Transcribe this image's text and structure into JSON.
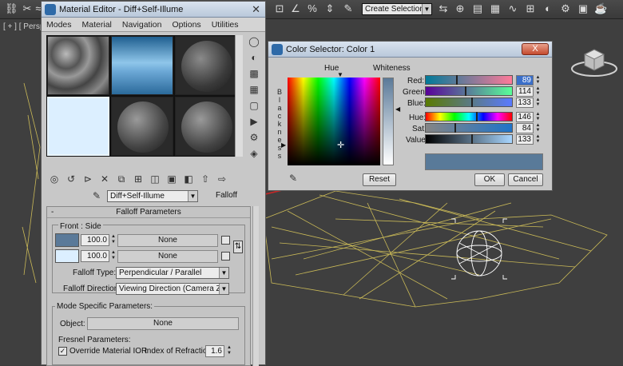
{
  "toolbar": {
    "selection_set_placeholder": "Create Selection Se"
  },
  "viewport": {
    "label": "[ + ] [ Persp"
  },
  "material_editor": {
    "title": "Material Editor - Diff+Self-Illume",
    "menu": [
      "Modes",
      "Material",
      "Navigation",
      "Options",
      "Utilities"
    ],
    "material_name": "Diff+Self-Illume",
    "material_type": "Falloff",
    "rollout_title": "Falloff Parameters",
    "front_side_label": "Front : Side",
    "row1_amount": "100.0",
    "row1_map": "None",
    "row2_amount": "100.0",
    "row2_map": "None",
    "falloff_type_label": "Falloff Type:",
    "falloff_type_value": "Perpendicular / Parallel",
    "falloff_direction_label": "Falloff Direction:",
    "falloff_direction_value": "Viewing Direction (Camera Z-Axis)",
    "mode_specific_label": "Mode Specific Parameters:",
    "object_label": "Object:",
    "object_value": "None",
    "fresnel_label": "Fresnel Parameters:",
    "override_ior_label": "Override Material IOR",
    "ior_label": "Index of Refraction",
    "ior_value": "1.6"
  },
  "color_selector": {
    "title": "Color Selector: Color 1",
    "hue_label": "Hue",
    "whiteness_label": "Whiteness",
    "blackness_label": "B l a c k n e s s",
    "reset_label": "Reset",
    "ok_label": "OK",
    "cancel_label": "Cancel",
    "close_label": "X",
    "red_label": "Red:",
    "red_value": "89",
    "green_label": "Green:",
    "green_value": "114",
    "blue_label": "Blue:",
    "blue_value": "133",
    "hue_value_label": "Hue:",
    "hue_value": "146",
    "sat_label": "Sat:",
    "sat_value": "84",
    "value_label": "Value:",
    "value_value": "133"
  },
  "colors": {
    "accent_line": "#c62828",
    "current_color": "#597a99",
    "wire": "#d9c75a"
  }
}
